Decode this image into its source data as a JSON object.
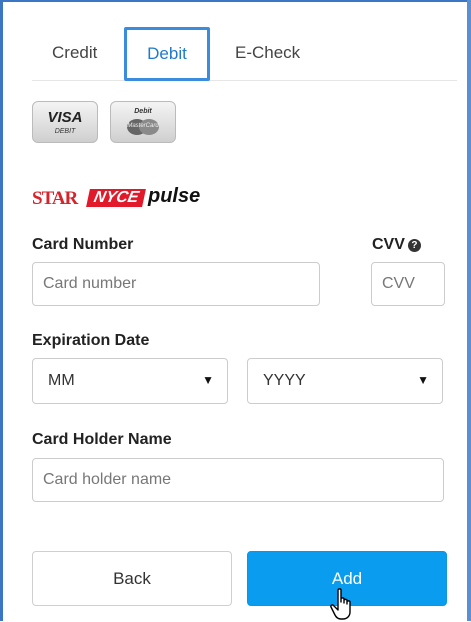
{
  "tabs": {
    "credit": "Credit",
    "debit": "Debit",
    "echeck": "E-Check"
  },
  "card_logos": {
    "visa": {
      "brand": "VISA",
      "sub": "DEBIT"
    },
    "mastercard": {
      "top": "Debit",
      "brand": "MasterCard"
    }
  },
  "networks": {
    "star": "STAR",
    "nyce": "NYCE",
    "pulse": "pulse"
  },
  "form": {
    "card_number_label": "Card Number",
    "card_number_placeholder": "Card number",
    "cvv_label": "CVV",
    "cvv_placeholder": "CVV",
    "expiration_label": "Expiration Date",
    "month_value": "MM",
    "year_value": "YYYY",
    "holder_label": "Card Holder Name",
    "holder_placeholder": "Card holder name"
  },
  "buttons": {
    "back": "Back",
    "add": "Add"
  },
  "colors": {
    "accent": "#0a9cef",
    "tab_active_border": "#3b8cdf",
    "frame": "#3a76c4"
  }
}
